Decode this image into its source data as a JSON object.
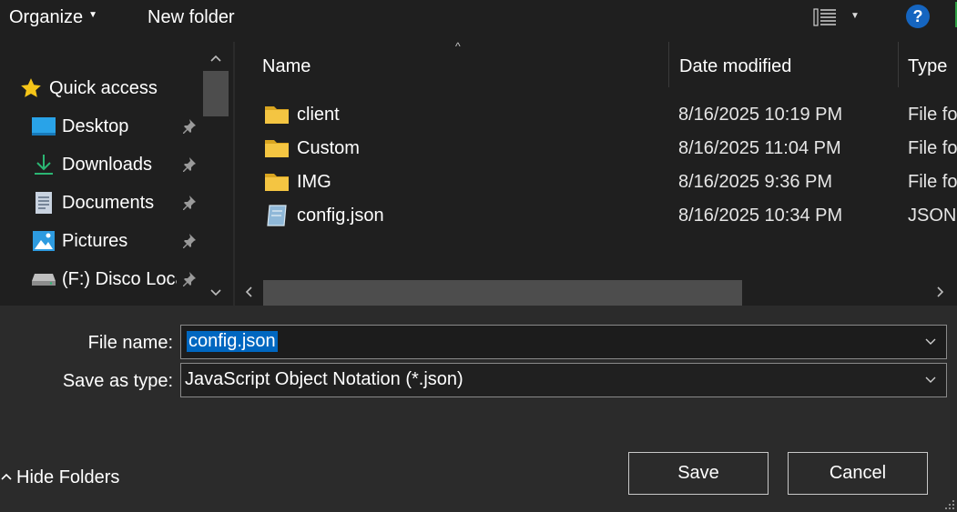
{
  "toolbar": {
    "organize_label": "Organize",
    "new_folder_label": "New folder",
    "view_icon": "details-view-icon",
    "help_label": "?"
  },
  "nav": {
    "quick_access_label": "Quick access",
    "items": [
      {
        "label": "Desktop",
        "icon": "desktop-icon",
        "pinned": true
      },
      {
        "label": "Downloads",
        "icon": "downloads-icon",
        "pinned": true
      },
      {
        "label": "Documents",
        "icon": "documents-icon",
        "pinned": true
      },
      {
        "label": "Pictures",
        "icon": "pictures-icon",
        "pinned": true
      },
      {
        "label": "(F:) Disco Loca",
        "icon": "drive-icon",
        "pinned": true
      }
    ]
  },
  "list": {
    "columns": [
      "Name",
      "Date modified",
      "Type"
    ],
    "rows": [
      {
        "name": "client",
        "date": "8/16/2025 10:19 PM",
        "type": "File fo",
        "icon": "folder-icon"
      },
      {
        "name": "Custom",
        "date": "8/16/2025 11:04 PM",
        "type": "File fo",
        "icon": "folder-icon"
      },
      {
        "name": "IMG",
        "date": "8/16/2025 9:36 PM",
        "type": "File fo",
        "icon": "folder-icon"
      },
      {
        "name": "config.json",
        "date": "8/16/2025 10:34 PM",
        "type": "JSON",
        "icon": "json-file-icon"
      }
    ]
  },
  "form": {
    "file_name_label": "File name:",
    "file_name_value": "config.json",
    "save_type_label": "Save as type:",
    "save_type_value": "JavaScript Object Notation (*.json)"
  },
  "footer": {
    "hide_folders_label": "Hide Folders",
    "save_label": "Save",
    "cancel_label": "Cancel"
  },
  "colors": {
    "toolbar_bg": "#1f1f1f",
    "dialog_bg": "#2b2b2b",
    "selection": "#0067c0",
    "folder": "#f4c542",
    "help": "#1565c0"
  }
}
